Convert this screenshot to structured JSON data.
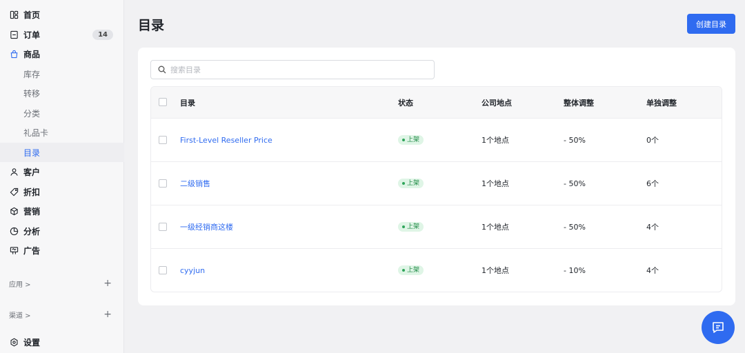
{
  "sidebar": {
    "items": [
      {
        "label": "首页",
        "icon": "layout-icon"
      },
      {
        "label": "订单",
        "icon": "order-icon",
        "badge": "14"
      },
      {
        "label": "商品",
        "icon": "bag-icon"
      },
      {
        "label": "库存"
      },
      {
        "label": "转移"
      },
      {
        "label": "分类"
      },
      {
        "label": "礼品卡"
      },
      {
        "label": "目录"
      },
      {
        "label": "客户",
        "icon": "user-icon"
      },
      {
        "label": "折扣",
        "icon": "tag-icon"
      },
      {
        "label": "营销",
        "icon": "cube-icon"
      },
      {
        "label": "分析",
        "icon": "pie-icon"
      },
      {
        "label": "广告",
        "icon": "billboard-icon"
      }
    ],
    "apps_label": "应用 >",
    "channels_label": "渠道 >",
    "add_symbol": "+",
    "settings_label": "设置"
  },
  "header": {
    "title": "目录",
    "create_label": "创建目录"
  },
  "search": {
    "placeholder": "搜索目录",
    "value": ""
  },
  "table": {
    "columns": [
      "目录",
      "状态",
      "公司地点",
      "整体调整",
      "单独调整"
    ],
    "rows": [
      {
        "name": "First-Level Reseller Price",
        "status": "上架",
        "locations": "1个地点",
        "overall": "- 50%",
        "individual": "0个"
      },
      {
        "name": "二级销售",
        "status": "上架",
        "locations": "1个地点",
        "overall": "- 50%",
        "individual": "6个"
      },
      {
        "name": "一级经销商这楼",
        "status": "上架",
        "locations": "1个地点",
        "overall": "- 50%",
        "individual": "4个"
      },
      {
        "name": "cyyjun",
        "status": "上架",
        "locations": "1个地点",
        "overall": "- 10%",
        "individual": "4个"
      }
    ]
  },
  "colors": {
    "accent": "#2f6bf0",
    "status_bg": "#dff5e6",
    "status_text": "#1f8a45"
  }
}
